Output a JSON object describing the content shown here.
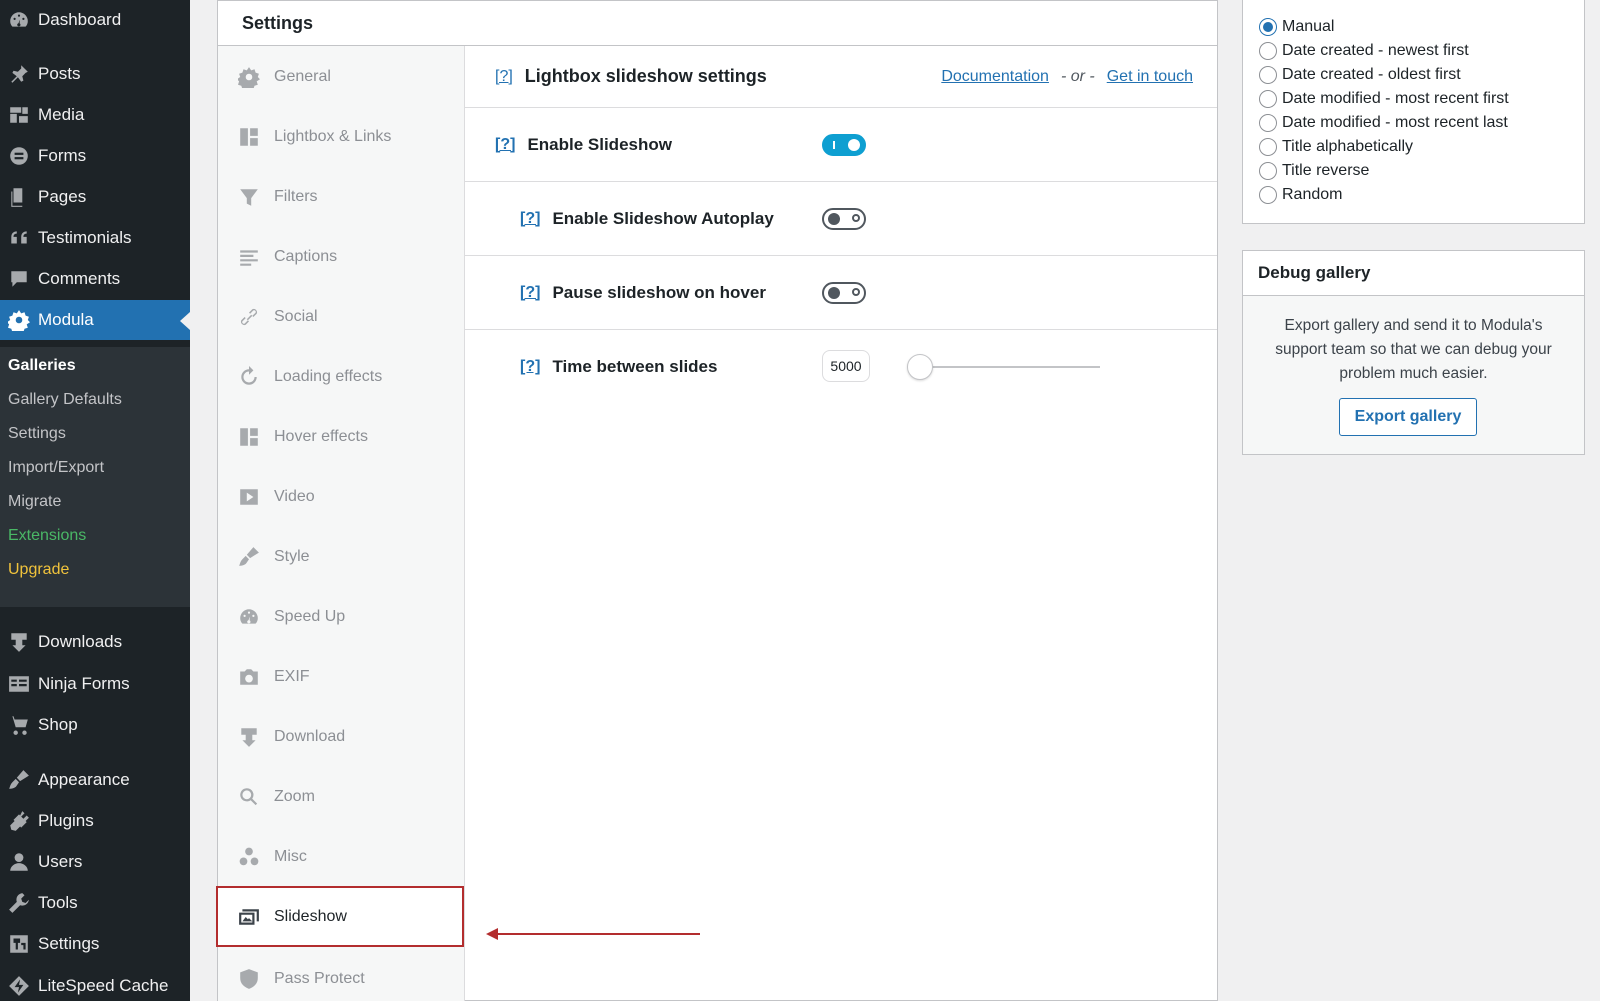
{
  "admin_menu": {
    "top": [
      {
        "label": "Dashboard",
        "icon": "dashboard-icon"
      },
      {
        "label": "Posts",
        "icon": "pin-icon"
      },
      {
        "label": "Media",
        "icon": "media-icon"
      },
      {
        "label": "Forms",
        "icon": "forms-icon"
      },
      {
        "label": "Pages",
        "icon": "pages-icon"
      },
      {
        "label": "Testimonials",
        "icon": "quote-icon"
      },
      {
        "label": "Comments",
        "icon": "comment-icon"
      },
      {
        "label": "Modula",
        "icon": "gear-icon"
      }
    ],
    "submenu": [
      {
        "label": "Galleries"
      },
      {
        "label": "Gallery Defaults"
      },
      {
        "label": "Settings"
      },
      {
        "label": "Import/Export"
      },
      {
        "label": "Migrate"
      },
      {
        "label": "Extensions"
      },
      {
        "label": "Upgrade"
      }
    ],
    "bottom": [
      {
        "label": "Downloads",
        "icon": "download-icon"
      },
      {
        "label": "Ninja Forms",
        "icon": "ninja-forms-icon"
      },
      {
        "label": "Shop",
        "icon": "cart-icon"
      },
      {
        "label": "Appearance",
        "icon": "brush-icon"
      },
      {
        "label": "Plugins",
        "icon": "plug-icon"
      },
      {
        "label": "Users",
        "icon": "user-icon"
      },
      {
        "label": "Tools",
        "icon": "wrench-icon"
      },
      {
        "label": "Settings",
        "icon": "settings-icon"
      },
      {
        "label": "LiteSpeed Cache",
        "icon": "litespeed-icon"
      }
    ]
  },
  "settings_panel": {
    "title": "Settings",
    "tabs": [
      {
        "label": "General"
      },
      {
        "label": "Lightbox & Links"
      },
      {
        "label": "Filters"
      },
      {
        "label": "Captions"
      },
      {
        "label": "Social"
      },
      {
        "label": "Loading effects"
      },
      {
        "label": "Hover effects"
      },
      {
        "label": "Video"
      },
      {
        "label": "Style"
      },
      {
        "label": "Speed Up"
      },
      {
        "label": "EXIF"
      },
      {
        "label": "Download"
      },
      {
        "label": "Zoom"
      },
      {
        "label": "Misc"
      },
      {
        "label": "Slideshow"
      },
      {
        "label": "Pass Protect"
      }
    ],
    "section": {
      "help": "[?]",
      "title": "Lightbox slideshow settings",
      "documentation": "Documentation",
      "or": "- or -",
      "get_in_touch": "Get in touch"
    },
    "rows": [
      {
        "help": "[?]",
        "label": "Enable Slideshow",
        "enabled": true
      },
      {
        "help": "[?]",
        "label": "Enable Slideshow Autoplay",
        "enabled": false
      },
      {
        "help": "[?]",
        "label": "Pause slideshow on hover",
        "enabled": false
      },
      {
        "help": "[?]",
        "label": "Time between slides",
        "value": "5000",
        "slider_fraction": 0.06
      }
    ]
  },
  "sort_options": {
    "selected": "Manual",
    "options": [
      "Manual",
      "Date created - newest first",
      "Date created - oldest first",
      "Date modified - most recent first",
      "Date modified - most recent last",
      "Title alphabetically",
      "Title reverse",
      "Random"
    ]
  },
  "debug_gallery": {
    "title": "Debug gallery",
    "text": "Export gallery and send it to Modula's support team so that we can debug your problem much easier.",
    "button": "Export gallery"
  },
  "colors": {
    "accent": "#2271b1",
    "highlight_border": "#b32d2e",
    "toggle_on": "#0e9fd1"
  }
}
